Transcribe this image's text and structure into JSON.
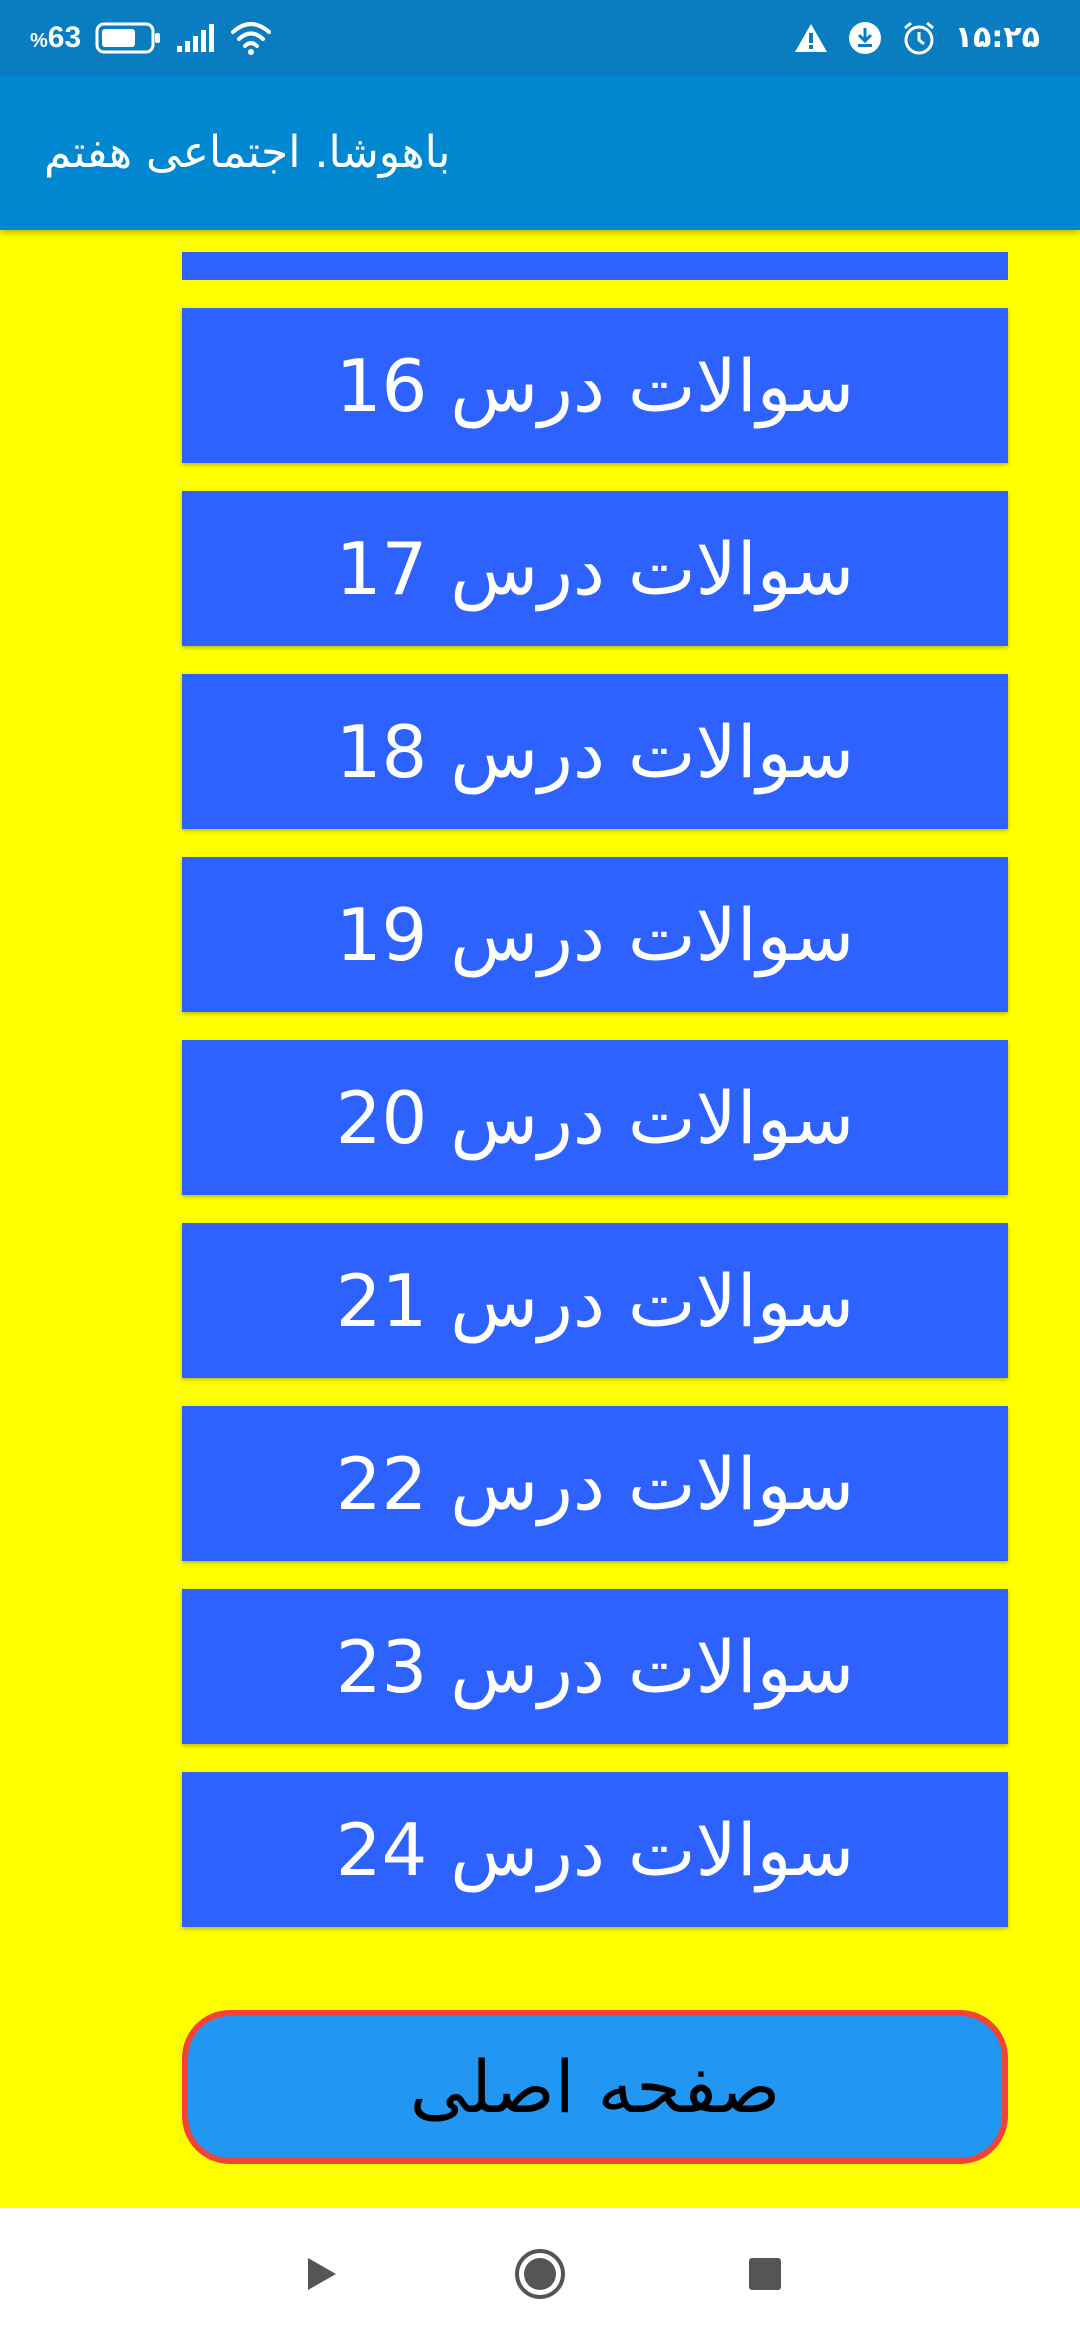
{
  "status_bar": {
    "battery_level": "63",
    "battery_percent_sign": "%",
    "time": "۱۵:۲۵",
    "icons": [
      "battery-icon",
      "signal-icon",
      "wifi-icon",
      "warning-icon",
      "download-icon",
      "alarm-icon"
    ]
  },
  "app_bar": {
    "title": "باهوشا. اجتماعی هفتم"
  },
  "lessons": [
    {
      "label": "سوالات درس 16"
    },
    {
      "label": "سوالات درس 17"
    },
    {
      "label": "سوالات درس 18"
    },
    {
      "label": "سوالات درس 19"
    },
    {
      "label": "سوالات درس 20"
    },
    {
      "label": "سوالات درس 21"
    },
    {
      "label": "سوالات درس 22"
    },
    {
      "label": "سوالات درس 23"
    },
    {
      "label": "سوالات درس 24"
    }
  ],
  "home_button": {
    "label": "صفحه اصلی"
  },
  "nav_bar": {
    "icons": [
      "back-icon",
      "home-icon",
      "recents-icon"
    ]
  },
  "colors": {
    "background": "#ffff00",
    "app_bar": "#0288d1",
    "status_bar": "#0a7dc0",
    "lesson_button": "#2d62fe",
    "home_button_fill": "#2196f3",
    "home_button_border": "#f44336"
  }
}
